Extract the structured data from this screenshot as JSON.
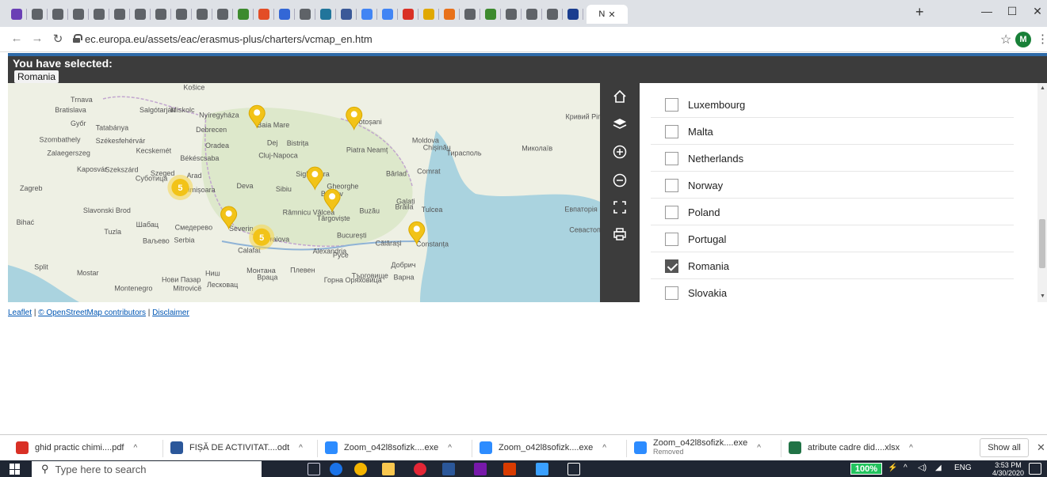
{
  "browser": {
    "active_tab_label": "N",
    "tab_colors": [
      "#6a3fb5",
      "#5f6368",
      "#5f6368",
      "#5f6368",
      "#5f6368",
      "#5f6368",
      "#5f6368",
      "#5f6368",
      "#5f6368",
      "#5f6368",
      "#5f6368",
      "#3d8a2e",
      "#e34d26",
      "#3367d6",
      "#5f6368",
      "#21759b",
      "#3b5998",
      "#4285f4",
      "#4285f4",
      "#d93025",
      "#e0a800",
      "#e8711a",
      "#5f6368",
      "#3d8a2e",
      "#5f6368",
      "#5f6368",
      "#5f6368",
      "#1a3d8f"
    ],
    "url": "ec.europa.eu/assets/eac/erasmus-plus/charters/vcmap_en.htm",
    "avatar_initial": "M"
  },
  "selection": {
    "label": "You have selected:",
    "chip": "Romania"
  },
  "map": {
    "clusters": [
      {
        "count": "5",
        "lon": 21.1,
        "lat": 45.9
      },
      {
        "count": "5",
        "lon": 23.7,
        "lat": 44.45
      }
    ],
    "markers": [
      {
        "lon": 23.55,
        "lat": 47.65
      },
      {
        "lon": 26.65,
        "lat": 47.6
      },
      {
        "lon": 25.4,
        "lat": 45.85
      },
      {
        "lon": 25.95,
        "lat": 45.2
      },
      {
        "lon": 22.65,
        "lat": 44.7
      },
      {
        "lon": 28.65,
        "lat": 44.25
      }
    ],
    "labels": [
      {
        "text": "Trnava",
        "lon": 17.6,
        "lat": 48.4
      },
      {
        "text": "Košice",
        "lon": 21.2,
        "lat": 48.75
      },
      {
        "text": "Bratislava",
        "lon": 17.1,
        "lat": 48.1
      },
      {
        "text": "Miskolc",
        "lon": 20.8,
        "lat": 48.1
      },
      {
        "text": "Salgótarján",
        "lon": 19.8,
        "lat": 48.1
      },
      {
        "text": "Nyíregyháza",
        "lon": 21.7,
        "lat": 47.95
      },
      {
        "text": "Botoșani",
        "lon": 26.65,
        "lat": 47.75
      },
      {
        "text": "Кривий Ріг",
        "lon": 33.4,
        "lat": 47.9
      },
      {
        "text": "Győr",
        "lon": 17.6,
        "lat": 47.7
      },
      {
        "text": "Tatabánya",
        "lon": 18.4,
        "lat": 47.58
      },
      {
        "text": "Debrecen",
        "lon": 21.6,
        "lat": 47.52
      },
      {
        "text": "Baia Mare",
        "lon": 23.55,
        "lat": 47.66
      },
      {
        "text": "Moldova",
        "lon": 28.5,
        "lat": 47.2
      },
      {
        "text": "Szombathely",
        "lon": 16.6,
        "lat": 47.23
      },
      {
        "text": "Székesfehérvár",
        "lon": 18.4,
        "lat": 47.19
      },
      {
        "text": "Oradea",
        "lon": 21.9,
        "lat": 47.05
      },
      {
        "text": "Dej",
        "lon": 23.87,
        "lat": 47.14
      },
      {
        "text": "Bistrița",
        "lon": 24.5,
        "lat": 47.13
      },
      {
        "text": "Chișinău",
        "lon": 28.85,
        "lat": 47.0
      },
      {
        "text": "Тирасполь",
        "lon": 29.6,
        "lat": 46.84
      },
      {
        "text": "Миколаїв",
        "lon": 32.0,
        "lat": 46.97
      },
      {
        "text": "Zalaegerszeg",
        "lon": 16.85,
        "lat": 46.84
      },
      {
        "text": "Kecskemét",
        "lon": 19.69,
        "lat": 46.9
      },
      {
        "text": "Békéscsaba",
        "lon": 21.1,
        "lat": 46.68
      },
      {
        "text": "Piatra Neamț",
        "lon": 26.4,
        "lat": 46.93
      },
      {
        "text": "Cluj-Napoca",
        "lon": 23.6,
        "lat": 46.77
      },
      {
        "text": "Szekszárd",
        "lon": 18.7,
        "lat": 46.35
      },
      {
        "text": "Szeged",
        "lon": 20.15,
        "lat": 46.25
      },
      {
        "text": "Sighișoara",
        "lon": 24.79,
        "lat": 46.22
      },
      {
        "text": "Bârlad",
        "lon": 27.67,
        "lat": 46.23
      },
      {
        "text": "Comrat",
        "lon": 28.66,
        "lat": 46.3
      },
      {
        "text": "Kaposvár",
        "lon": 17.8,
        "lat": 46.36
      },
      {
        "text": "Zagreb",
        "lon": 15.98,
        "lat": 45.81
      },
      {
        "text": "Суботица",
        "lon": 19.67,
        "lat": 46.1
      },
      {
        "text": "Arad",
        "lon": 21.31,
        "lat": 46.18
      },
      {
        "text": "Deva",
        "lon": 22.9,
        "lat": 45.88
      },
      {
        "text": "Timișoara",
        "lon": 21.23,
        "lat": 45.76
      },
      {
        "text": "Sibiu",
        "lon": 24.15,
        "lat": 45.79
      },
      {
        "text": "Gheorghe",
        "lon": 25.78,
        "lat": 45.86
      },
      {
        "text": "Brașov",
        "lon": 25.59,
        "lat": 45.65
      },
      {
        "text": "Galați",
        "lon": 28.0,
        "lat": 45.43
      },
      {
        "text": "Slavonski Brod",
        "lon": 18.0,
        "lat": 45.16
      },
      {
        "text": "Râmnicu Vâlcea",
        "lon": 24.37,
        "lat": 45.1
      },
      {
        "text": "Buzău",
        "lon": 26.82,
        "lat": 45.15
      },
      {
        "text": "Brăila",
        "lon": 27.96,
        "lat": 45.27
      },
      {
        "text": "Tulcea",
        "lon": 28.8,
        "lat": 45.18
      },
      {
        "text": "Евпаторія",
        "lon": 33.37,
        "lat": 45.19
      },
      {
        "text": "Bihać",
        "lon": 15.87,
        "lat": 44.81
      },
      {
        "text": "Tuzla",
        "lon": 18.67,
        "lat": 44.54
      },
      {
        "text": "Шабац",
        "lon": 19.69,
        "lat": 44.75
      },
      {
        "text": "Смедерево",
        "lon": 20.93,
        "lat": 44.66
      },
      {
        "text": "Severin",
        "lon": 22.66,
        "lat": 44.63
      },
      {
        "text": "Târgoviște",
        "lon": 25.46,
        "lat": 44.93
      },
      {
        "text": "București",
        "lon": 26.1,
        "lat": 44.43
      },
      {
        "text": "Севастополь",
        "lon": 33.52,
        "lat": 44.6
      },
      {
        "text": "Serbia",
        "lon": 20.9,
        "lat": 44.3
      },
      {
        "text": "Craiova",
        "lon": 23.8,
        "lat": 44.32
      },
      {
        "text": "Constanța",
        "lon": 28.63,
        "lat": 44.18
      },
      {
        "text": "Ваљево",
        "lon": 19.9,
        "lat": 44.27
      },
      {
        "text": "Calafat",
        "lon": 22.94,
        "lat": 43.99
      },
      {
        "text": "Alexandria",
        "lon": 25.33,
        "lat": 43.97
      },
      {
        "text": "Călărași",
        "lon": 27.33,
        "lat": 44.2
      },
      {
        "text": "Split",
        "lon": 16.44,
        "lat": 43.51
      },
      {
        "text": "Mostar",
        "lon": 17.8,
        "lat": 43.34
      },
      {
        "text": "Монтана",
        "lon": 23.22,
        "lat": 43.41
      },
      {
        "text": "Плевен",
        "lon": 24.61,
        "lat": 43.42
      },
      {
        "text": "Русе",
        "lon": 25.97,
        "lat": 43.85
      },
      {
        "text": "Добрич",
        "lon": 27.83,
        "lat": 43.57
      },
      {
        "text": "Ниш",
        "lon": 21.9,
        "lat": 43.32
      },
      {
        "text": "Търговище",
        "lon": 26.57,
        "lat": 43.25
      },
      {
        "text": "Варна",
        "lon": 27.91,
        "lat": 43.21
      },
      {
        "text": "Нови Пазар",
        "lon": 20.51,
        "lat": 43.14
      },
      {
        "text": "Лесковац",
        "lon": 21.95,
        "lat": 42.99
      },
      {
        "text": "Враца",
        "lon": 23.55,
        "lat": 43.21
      },
      {
        "text": "Горна Оряховица",
        "lon": 25.69,
        "lat": 43.13
      },
      {
        "text": "Montenegro",
        "lon": 19.0,
        "lat": 42.88
      },
      {
        "text": "Mitrovicë",
        "lon": 20.87,
        "lat": 42.89
      }
    ]
  },
  "toolbar": {
    "home_icon": "home-icon",
    "layers_icon": "layers-icon",
    "zoom_in_icon": "zoom-in-icon",
    "zoom_out_icon": "zoom-out-icon",
    "fullscreen_icon": "fullscreen-icon",
    "print_icon": "print-icon"
  },
  "countries": [
    {
      "name": "Luxembourg",
      "checked": false
    },
    {
      "name": "Malta",
      "checked": false
    },
    {
      "name": "Netherlands",
      "checked": false
    },
    {
      "name": "Norway",
      "checked": false
    },
    {
      "name": "Poland",
      "checked": false
    },
    {
      "name": "Portugal",
      "checked": false
    },
    {
      "name": "Romania",
      "checked": true
    },
    {
      "name": "Slovakia",
      "checked": false
    }
  ],
  "attribution": {
    "leaflet": "Leaflet",
    "osm": "© OpenStreetMap contributors",
    "disclaimer": "Disclaimer",
    "sep": "|"
  },
  "downloads": {
    "items": [
      {
        "name": "ghid practic chimi....pdf",
        "sub": "",
        "color": "#d93025"
      },
      {
        "name": "FIȘĂ DE ACTIVITAT....odt",
        "sub": "",
        "color": "#2b579a"
      },
      {
        "name": "Zoom_o42l8sofizk....exe",
        "sub": "",
        "color": "#2d8cff"
      },
      {
        "name": "Zoom_o42l8sofizk....exe",
        "sub": "",
        "color": "#2d8cff"
      },
      {
        "name": "Zoom_o42l8sofizk....exe",
        "sub": "Removed",
        "color": "#2d8cff"
      },
      {
        "name": "atribute cadre did....xlsx",
        "sub": "",
        "color": "#217346"
      }
    ],
    "show_all": "Show all"
  },
  "taskbar": {
    "search_placeholder": "Type here to search",
    "battery": "100%",
    "lang": "ENG",
    "time": "3:53 PM",
    "date": "4/30/2020"
  }
}
